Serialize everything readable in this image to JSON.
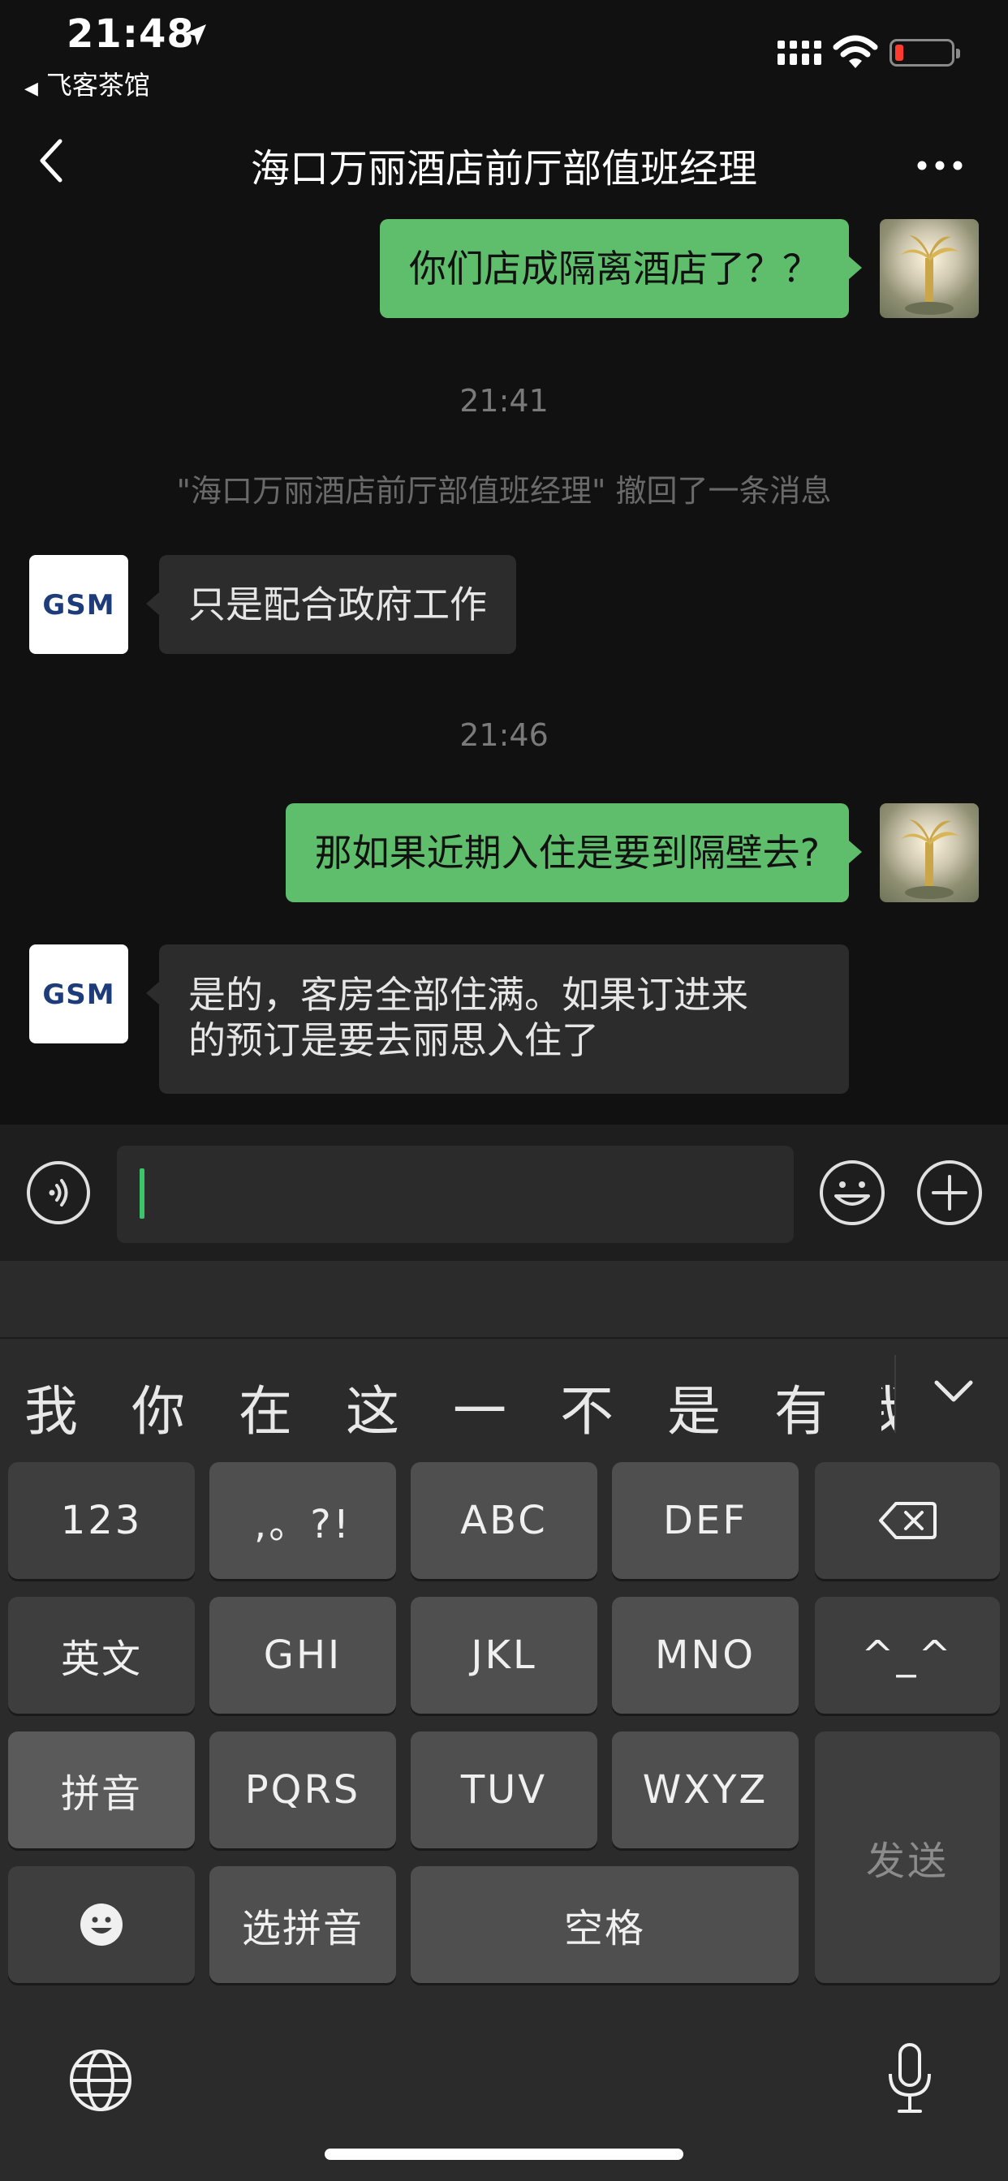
{
  "status": {
    "time": "21:48",
    "back_app": "飞客茶馆"
  },
  "nav": {
    "title": "海口万丽酒店前厅部值班经理"
  },
  "chat": {
    "messages": [
      {
        "text": "你们店成隔离酒店了？？"
      },
      {
        "timestamp": "21:41"
      },
      {
        "recall_notice": "\"海口万丽酒店前厅部值班经理\" 撤回了一条消息"
      },
      {
        "text": "只是配合政府工作"
      },
      {
        "timestamp": "21:46"
      },
      {
        "text": "那如果近期入住是要到隔壁去?"
      },
      {
        "text_line1": "是的，客房全部住满。如果订进来",
        "text_line2": "的预订是要去丽思入住了"
      }
    ],
    "avatar_other_label": "GSM"
  },
  "input": {
    "value": ""
  },
  "keyboard": {
    "candidates": [
      "我",
      "你",
      "在",
      "这",
      "一",
      "不",
      "是",
      "有",
      "我"
    ],
    "keys": {
      "num": "123",
      "punct": ",。?!",
      "abc": "ABC",
      "def": "DEF",
      "english": "英文",
      "ghi": "GHI",
      "jkl": "JKL",
      "mno": "MNO",
      "face": "^_^",
      "pinyin": "拼音",
      "pqrs": "PQRS",
      "tuv": "TUV",
      "wxyz": "WXYZ",
      "send": "发送",
      "select_pinyin": "选拼音",
      "space": "空格"
    }
  },
  "colors": {
    "bubble_self": "#5fbe6c",
    "bubble_other": "#2c2c2c",
    "background": "#111111",
    "battery_low": "#ff3b30"
  }
}
